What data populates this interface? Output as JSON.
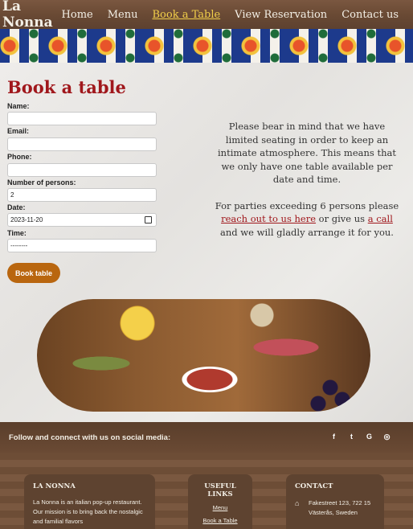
{
  "header": {
    "brand": "La Nonna",
    "nav": [
      "Home",
      "Menu",
      "Book a Table",
      "View Reservation",
      "Contact us"
    ],
    "active_nav": "Book a Table"
  },
  "form": {
    "title": "Book a table",
    "fields": [
      {
        "label": "Name:",
        "value": ""
      },
      {
        "label": "Email:",
        "value": ""
      },
      {
        "label": "Phone:",
        "value": ""
      },
      {
        "label": "Number of persons:",
        "value": "2"
      },
      {
        "label": "Date:",
        "value": "2023-11-20"
      },
      {
        "label": "Time:",
        "value": "--------"
      }
    ],
    "submit_label": "Book table"
  },
  "info": {
    "p1": "Please bear in mind that we have limited seating in order to keep an intimate atmosphere. This means that we only have one table available per date and time.",
    "p2_prefix": "For parties exceeding 6 persons please ",
    "p2_link1": "reach out to us here",
    "p2_mid": " or give us ",
    "p2_link2": "a call",
    "p2_suffix": " and we will gladly arrange it for you."
  },
  "social": {
    "text": "Follow and connect with us on social media:",
    "icons": [
      {
        "name": "facebook-icon",
        "glyph": "f"
      },
      {
        "name": "twitter-icon",
        "glyph": "t"
      },
      {
        "name": "google-icon",
        "glyph": "G"
      },
      {
        "name": "instagram-icon",
        "glyph": "◎"
      }
    ]
  },
  "footer": {
    "about_title": "LA NONNA",
    "about_text": "La Nonna is an italian pop-up restaurant. Our mission is to bring back the nostalgic and familial flavors",
    "links_title": "USEFUL LINKS",
    "links": [
      "Menu",
      "Book a Table"
    ],
    "contact_title": "CONTACT",
    "address": "Fakestreet 123, 722 15 Västerås, Sweden"
  }
}
